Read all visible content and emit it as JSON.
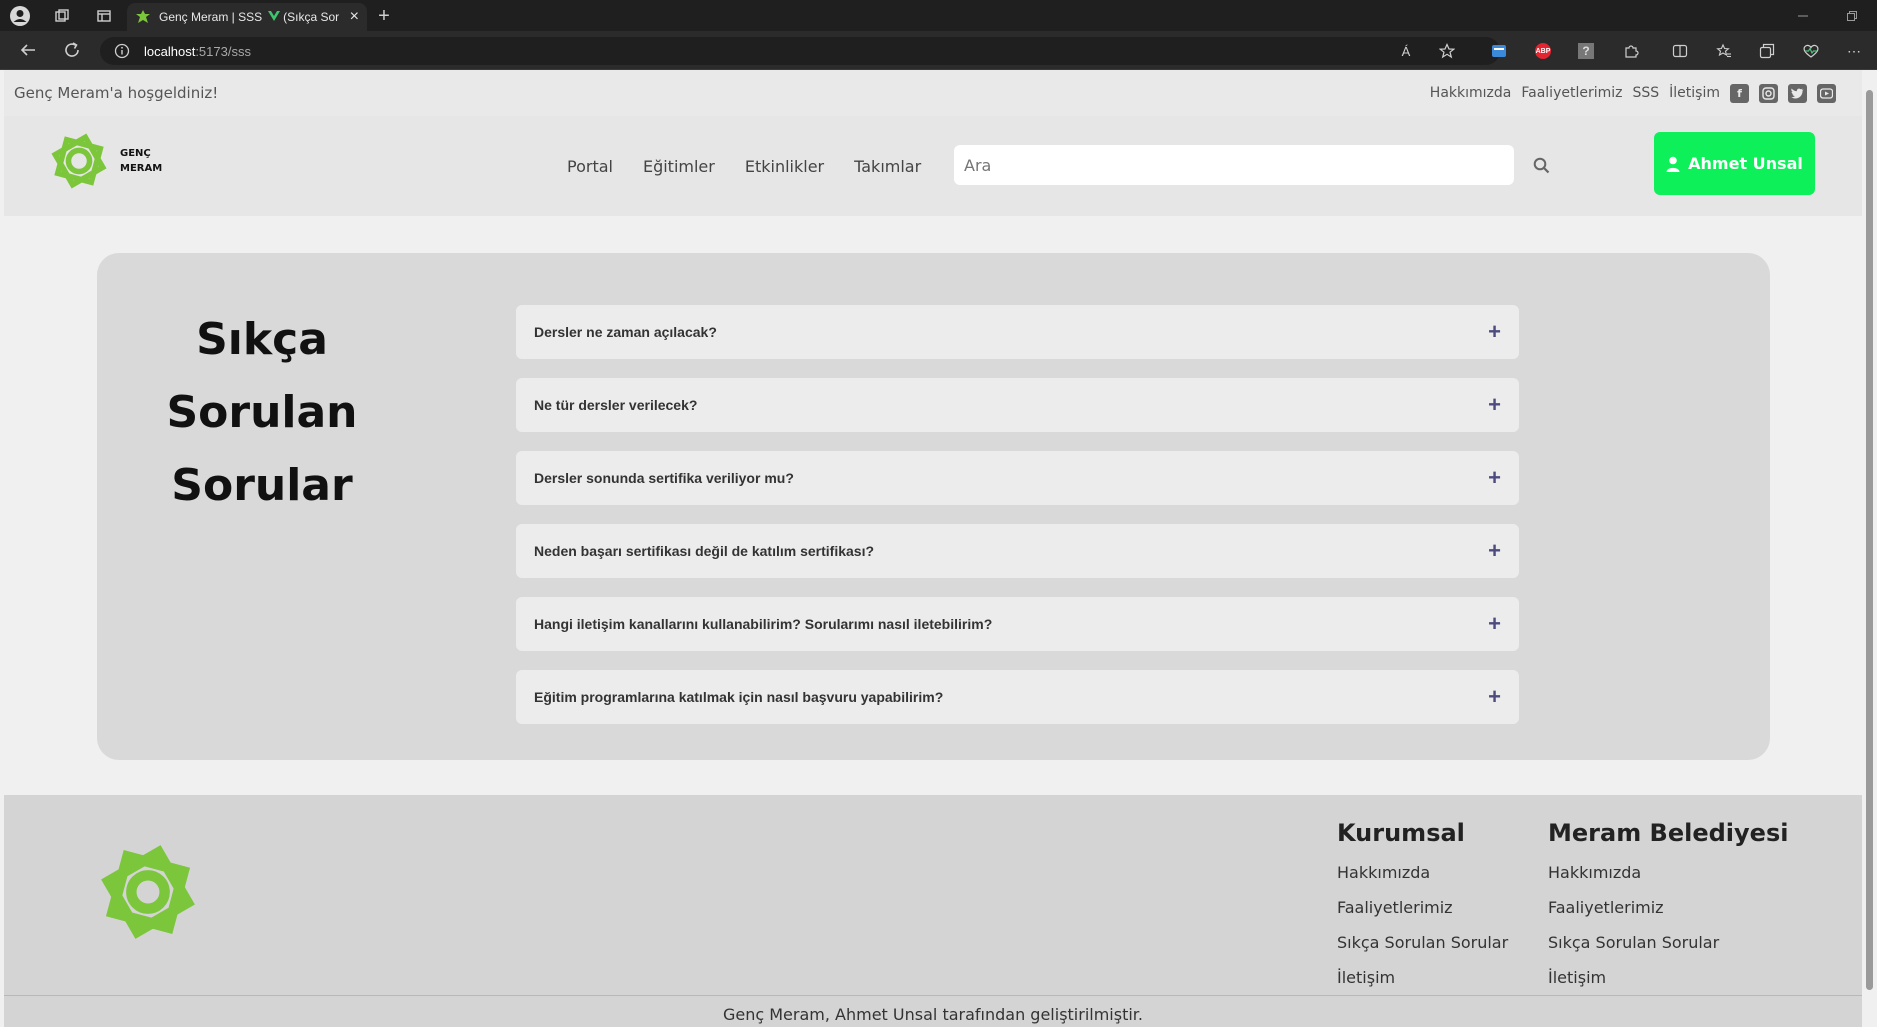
{
  "browser": {
    "tab_title": "Genç Meram | SSS",
    "tab_title_suffix": "(Sıkça Sor",
    "url_host": "localhost",
    "url_path": ":5173/sss",
    "read_aloud": "Á",
    "adblock": "ABP",
    "unknown_ext": "?"
  },
  "topbar": {
    "welcome": "Genç Meram'a hoşgeldiniz!",
    "links": [
      "Hakkımızda",
      "Faaliyetlerimiz",
      "SSS",
      "İletişim"
    ],
    "socials": [
      "facebook-icon",
      "instagram-icon",
      "twitter-icon",
      "youtube-icon"
    ]
  },
  "header": {
    "logo_line1": "GENÇ",
    "logo_line2": "MERAM",
    "nav": [
      "Portal",
      "Eğitimler",
      "Etkinlikler",
      "Takımlar"
    ],
    "search_placeholder": "Ara",
    "user_name": "Ahmet Unsal",
    "accent_color": "#0ef05a",
    "logo_color": "#7cc63b"
  },
  "faq": {
    "title_lines": [
      "Sıkça",
      "Sorulan",
      "Sorular"
    ],
    "items": [
      "Dersler ne zaman açılacak?",
      "Ne tür dersler verilecek?",
      "Dersler sonunda sertifika veriliyor mu?",
      "Neden başarı sertifikası değil de katılım sertifikası?",
      "Hangi iletişim kanallarını kullanabilirim? Sorularımı nasıl iletebilirim?",
      "Eğitim programlarına katılmak için nasıl başvuru yapabilirim?"
    ],
    "expand_symbol": "+"
  },
  "footer": {
    "columns": [
      {
        "heading": "Kurumsal",
        "links": [
          "Hakkımızda",
          "Faaliyetlerimiz",
          "Sıkça Sorulan Sorular",
          "İletişim"
        ]
      },
      {
        "heading": "Meram Belediyesi",
        "links": [
          "Hakkımızda",
          "Faaliyetlerimiz",
          "Sıkça Sorulan Sorular",
          "İletişim"
        ]
      }
    ],
    "credits": "Genç Meram, Ahmet Unsal tarafından geliştirilmiştir."
  }
}
